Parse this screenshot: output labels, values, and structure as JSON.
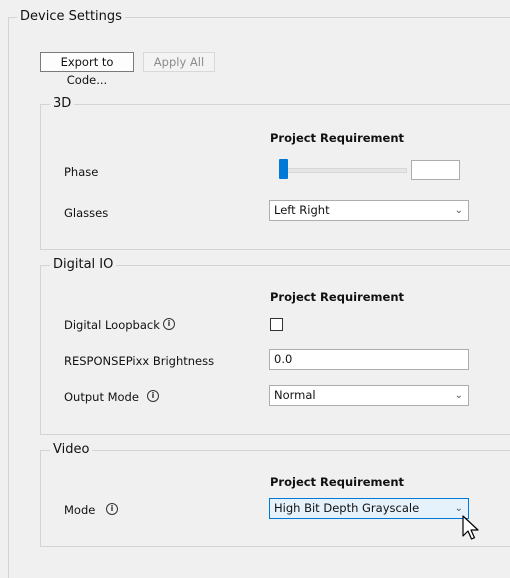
{
  "group_title": "Device Settings",
  "toolbar": {
    "export_label": "Export to Code...",
    "apply_label": "Apply All"
  },
  "sections": {
    "three_d": {
      "title": "3D",
      "header": "Project Requirement",
      "phase_label": "Phase",
      "phase_value": "",
      "phase_slider_fraction": 0.0,
      "glasses_label": "Glasses",
      "glasses_value": "Left Right"
    },
    "digital_io": {
      "title": "Digital IO",
      "header": "Project Requirement",
      "loopback_label": "Digital Loopback",
      "loopback_checked": false,
      "brightness_label": "RESPONSEPixx Brightness",
      "brightness_value": "0.0",
      "output_mode_label": "Output Mode",
      "output_mode_value": "Normal"
    },
    "video": {
      "title": "Video",
      "header": "Project Requirement",
      "mode_label": "Mode",
      "mode_value": "High Bit Depth Grayscale"
    }
  },
  "icons": {
    "info": "info-icon",
    "chevron": "chevron-down-icon",
    "cursor": "mouse-pointer-icon"
  },
  "colors": {
    "accent": "#0078d7",
    "active_dropdown_bg": "#e5f1fb"
  }
}
